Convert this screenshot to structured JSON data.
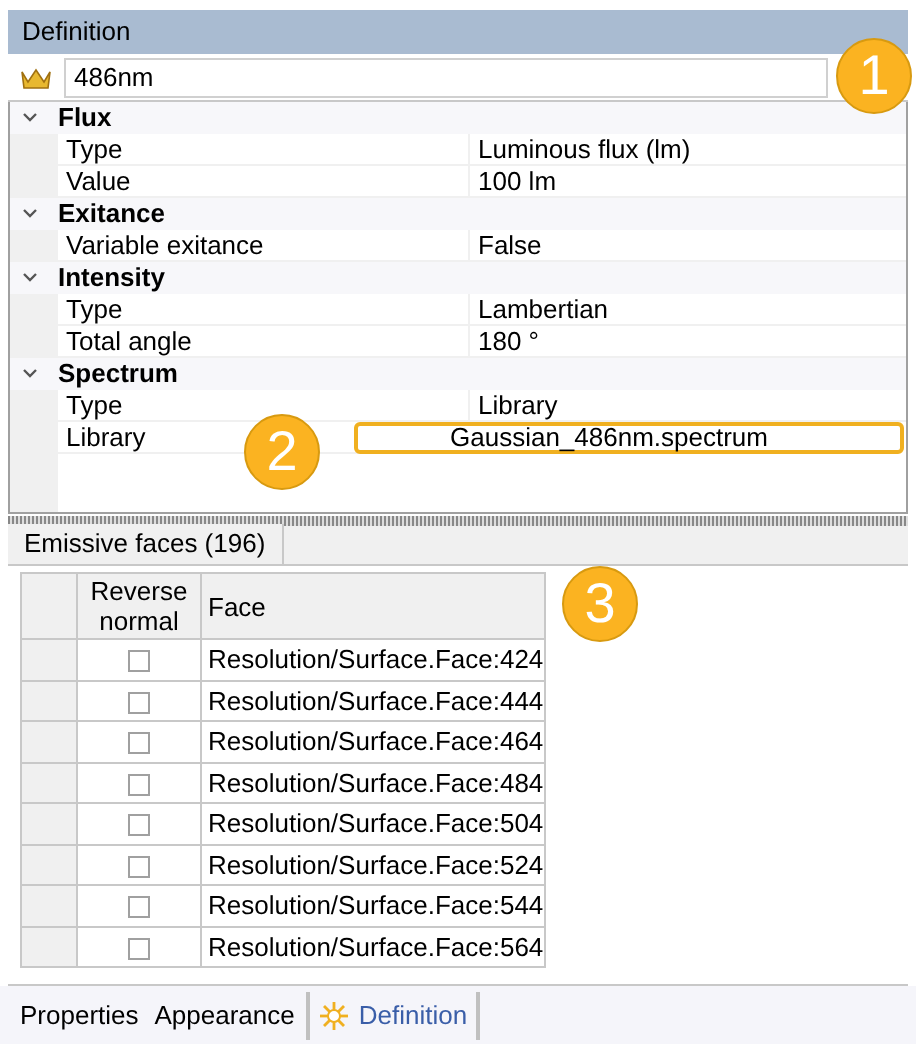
{
  "panel": {
    "title": "Definition"
  },
  "name_field": {
    "value": "486nm"
  },
  "properties": [
    {
      "group": "Flux",
      "expanded": true,
      "rows": [
        {
          "label": "Type",
          "value": "Luminous flux (lm)",
          "highlighted": false
        },
        {
          "label": "Value",
          "value": "100 lm",
          "highlighted": false
        }
      ]
    },
    {
      "group": "Exitance",
      "expanded": true,
      "rows": [
        {
          "label": "Variable exitance",
          "value": "False",
          "highlighted": false
        }
      ]
    },
    {
      "group": "Intensity",
      "expanded": true,
      "rows": [
        {
          "label": "Type",
          "value": "Lambertian",
          "highlighted": false
        },
        {
          "label": "Total angle",
          "value": "180 °",
          "highlighted": false
        }
      ]
    },
    {
      "group": "Spectrum",
      "expanded": true,
      "rows": [
        {
          "label": "Type",
          "value": "Library",
          "highlighted": false
        },
        {
          "label": "Library",
          "value": "Gaussian_486nm.spectrum",
          "highlighted": true
        }
      ]
    }
  ],
  "faces_tab": {
    "label": "Emissive faces (196)"
  },
  "faces_table": {
    "columns": [
      "Reverse\nnormal",
      "Face"
    ],
    "rows": [
      {
        "checked": false,
        "face": "Resolution/Surface.Face:424"
      },
      {
        "checked": false,
        "face": "Resolution/Surface.Face:444"
      },
      {
        "checked": false,
        "face": "Resolution/Surface.Face:464"
      },
      {
        "checked": false,
        "face": "Resolution/Surface.Face:484"
      },
      {
        "checked": false,
        "face": "Resolution/Surface.Face:504"
      },
      {
        "checked": false,
        "face": "Resolution/Surface.Face:524"
      },
      {
        "checked": false,
        "face": "Resolution/Surface.Face:544"
      },
      {
        "checked": false,
        "face": "Resolution/Surface.Face:564"
      }
    ]
  },
  "bottom_tabs": [
    {
      "label": "Properties",
      "selected": false
    },
    {
      "label": "Appearance",
      "selected": false
    },
    {
      "label": "Definition",
      "selected": true
    }
  ],
  "callouts": [
    "1",
    "2",
    "3"
  ]
}
